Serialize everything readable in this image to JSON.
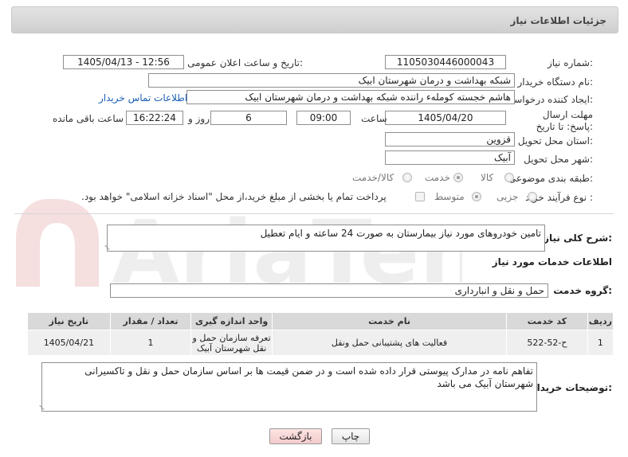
{
  "header": {
    "title": "جزئیات اطلاعات نیاز"
  },
  "fields": {
    "need_number_label": "شماره نیاز:",
    "need_number": "1105030446000043",
    "announce_label": "تاریخ و ساعت اعلان عمومی:",
    "announce_value": "1405/04/13 - 12:56",
    "buyer_org_label": "نام دستگاه خریدار:",
    "buyer_org": "شبکه بهداشت و درمان شهرستان ابیک",
    "requester_label": "ایجاد کننده درخواست:",
    "requester": "هاشم خجسته کوملهء راننده شبکه بهداشت و درمان شهرستان ابیک",
    "contact_link": "اطلاعات تماس خریدار",
    "deadline_label": "مهلت ارسال پاسخ: تا تاریخ:",
    "deadline_date": "1405/04/20",
    "time_label": "ساعت",
    "deadline_time": "09:00",
    "days_value": "6",
    "days_label": "روز و",
    "remaining_time": "16:22:24",
    "remaining_label": "ساعت باقی مانده",
    "province_label": "استان محل تحویل:",
    "province": "قزوین",
    "city_label": "شهر محل تحویل:",
    "city": "آبیک",
    "category_label": "طبقه بندی موضوعی:",
    "category_options": [
      "کالا",
      "خدمت",
      "کالا/خدمت"
    ],
    "category_selected": "خدمت",
    "purchase_type_label": "نوع فرآیند خرید :",
    "purchase_type_options": [
      "جزیی",
      "متوسط"
    ],
    "purchase_type_selected": "متوسط",
    "payment_note": "پرداخت تمام یا بخشی از مبلغ خرید،از محل \"اسناد خزانه اسلامی\" خواهد بود."
  },
  "summary": {
    "label": "شرح کلی نیاز:",
    "value": "تامین خودروهای مورد نیاز بیمارستان به صورت 24 ساعته و ایام تعطیل"
  },
  "services_section": {
    "title": "اطلاعات خدمات مورد نیاز",
    "group_label": "گروه خدمت:",
    "group_value": "حمل و نقل و انبارداری"
  },
  "table": {
    "headers": [
      "ردیف",
      "کد خدمت",
      "نام خدمت",
      "واحد اندازه گیری",
      "تعداد / مقدار",
      "تاریخ نیاز"
    ],
    "rows": [
      [
        "1",
        "ح-52-522",
        "فعالیت های پشتیبانی حمل ونقل",
        "تعرفه سازمان حمل و نقل شهرستان آبیک",
        "1",
        "1405/04/21"
      ]
    ]
  },
  "buyer_notes": {
    "label": "توضیحات خریدار:",
    "value": "تفاهم نامه در مدارک پیوستی قرار داده شده است و در ضمن قیمت ها بر اساس سازمان حمل و نقل و تاکسیرانی شهرستان آبیک می باشد"
  },
  "buttons": {
    "print": "چاپ",
    "back": "بازگشت"
  },
  "watermark": {
    "text": "AriaTender.net"
  },
  "colors": {
    "link": "#1a5fb4",
    "header_bg": "#d6d6d6",
    "back_button": "#f3caca"
  }
}
